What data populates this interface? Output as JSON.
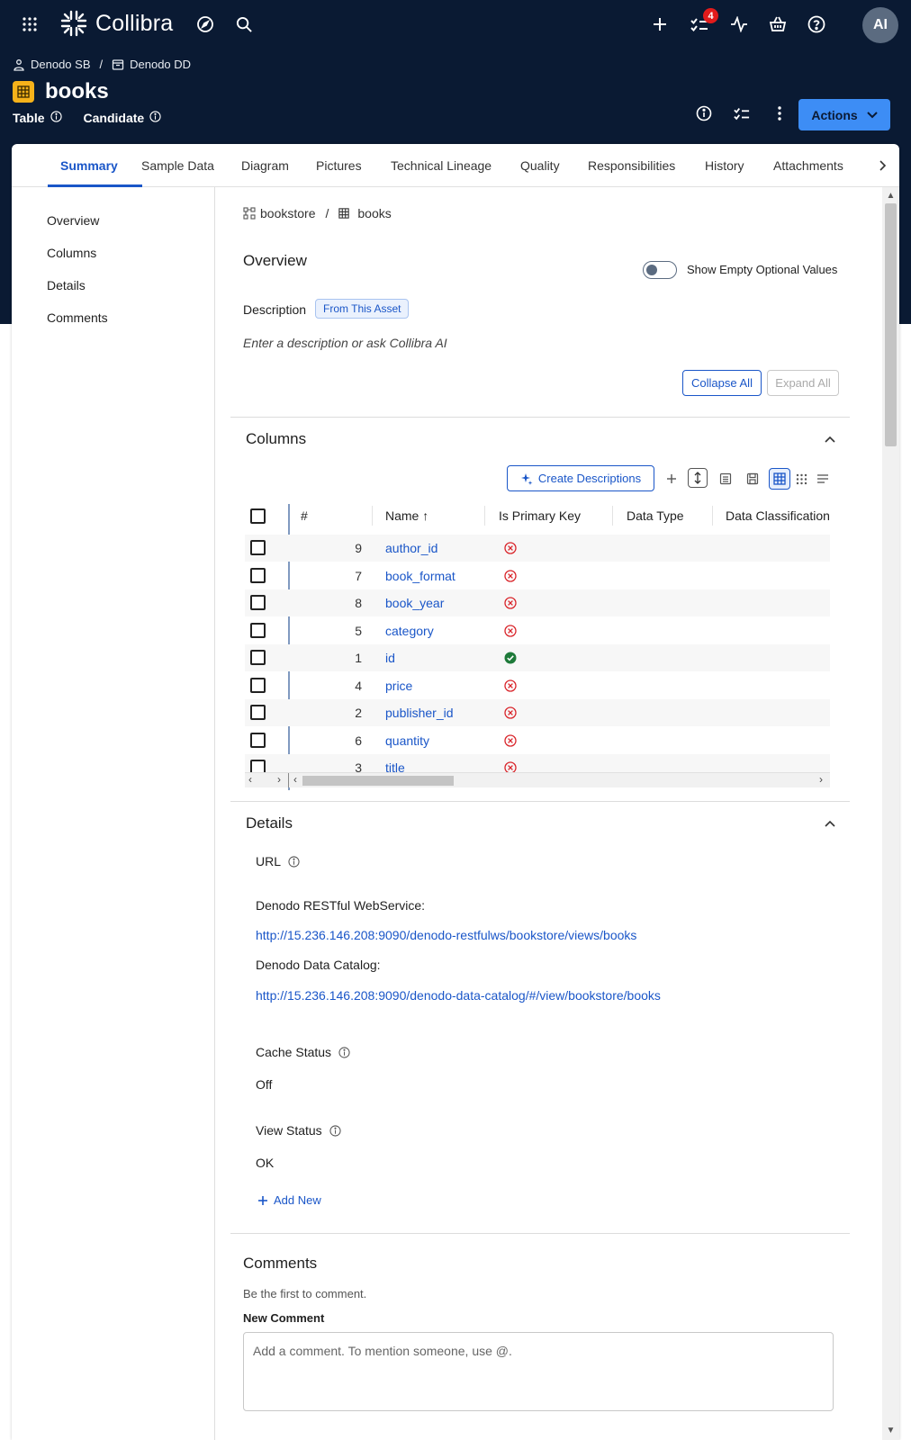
{
  "app": {
    "brand": "Collibra",
    "notif_count": "4",
    "avatar_initials": "AI"
  },
  "breadcrumb": {
    "community": "Denodo SB",
    "domain": "Denodo DD"
  },
  "asset": {
    "title": "books",
    "type": "Table",
    "status": "Candidate"
  },
  "header": {
    "actions_label": "Actions"
  },
  "tabs": [
    {
      "label": "Summary"
    },
    {
      "label": "Sample Data"
    },
    {
      "label": "Diagram"
    },
    {
      "label": "Pictures"
    },
    {
      "label": "Technical Lineage"
    },
    {
      "label": "Quality"
    },
    {
      "label": "Responsibilities"
    },
    {
      "label": "History"
    },
    {
      "label": "Attachments"
    }
  ],
  "leftnav": [
    {
      "label": "Overview"
    },
    {
      "label": "Columns"
    },
    {
      "label": "Details"
    },
    {
      "label": "Comments"
    }
  ],
  "content_crumbs": {
    "schema": "bookstore",
    "table": "books"
  },
  "overview": {
    "title": "Overview",
    "toggle_label": "Show Empty Optional Values",
    "description_label": "Description",
    "description_chip": "From This Asset",
    "description_placeholder": "Enter a description or ask Collibra AI",
    "collapse_all": "Collapse All",
    "expand_all": "Expand All"
  },
  "columns": {
    "title": "Columns",
    "create_descriptions": "Create Descriptions",
    "headers": {
      "num": "#",
      "name": "Name ↑",
      "pk": "Is Primary Key",
      "type": "Data Type",
      "classification": "Data Classification"
    },
    "rows": [
      {
        "num": "9",
        "name": "author_id",
        "pk": false
      },
      {
        "num": "7",
        "name": "book_format",
        "pk": false
      },
      {
        "num": "8",
        "name": "book_year",
        "pk": false
      },
      {
        "num": "5",
        "name": "category",
        "pk": false
      },
      {
        "num": "1",
        "name": "id",
        "pk": true
      },
      {
        "num": "4",
        "name": "price",
        "pk": false
      },
      {
        "num": "2",
        "name": "publisher_id",
        "pk": false
      },
      {
        "num": "6",
        "name": "quantity",
        "pk": false
      },
      {
        "num": "3",
        "name": "title",
        "pk": false
      }
    ]
  },
  "details": {
    "title": "Details",
    "url_label": "URL",
    "rest_label": "Denodo RESTful WebService:",
    "rest_url": "http://15.236.146.208:9090/denodo-restfulws/bookstore/views/books",
    "catalog_label": "Denodo Data Catalog:",
    "catalog_url": "http://15.236.146.208:9090/denodo-data-catalog/#/view/bookstore/books",
    "cache_label": "Cache Status",
    "cache_value": "Off",
    "view_label": "View Status",
    "view_value": "OK",
    "add_new": "Add New"
  },
  "comments": {
    "title": "Comments",
    "empty": "Be the first to comment.",
    "new_label": "New Comment",
    "placeholder": "Add a comment. To mention someone, use @."
  },
  "colors": {
    "accent": "#1a56c8",
    "header_bg": "#0a1a33",
    "primary_btn": "#3d8df5",
    "pk_yes": "#1e7a3a",
    "pk_no": "#d9252b"
  }
}
